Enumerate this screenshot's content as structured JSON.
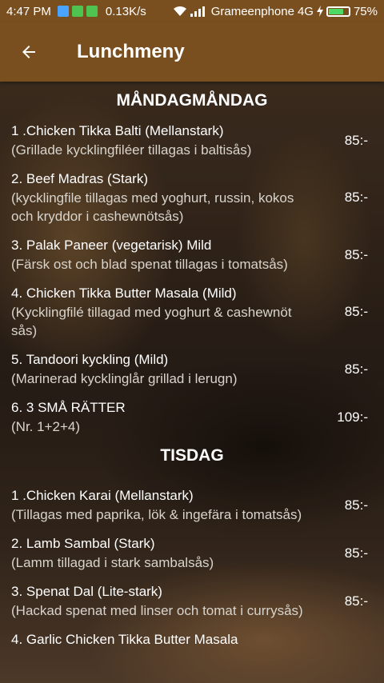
{
  "status_bar": {
    "time": "4:47 PM",
    "speed": "0.13K/s",
    "carrier": "Grameenphone",
    "network": "4G",
    "battery": "75%",
    "battery_level": 0.75
  },
  "app_bar": {
    "title": "Lunchmeny",
    "back_icon": "arrow-left-icon"
  },
  "days": [
    {
      "day": "MÅNDAGMÅNDAG",
      "items": [
        {
          "name": "1 .Chicken Tikka Balti (Mellanstark)",
          "desc": "(Grillade kycklingfiléer tillagas i baltisås)",
          "price": "85:-"
        },
        {
          "name": "2. Beef Madras (Stark)",
          "desc": "(kycklingfile tillagas med yoghurt, russin, kokos och kryddor i cashewnötsås)",
          "price": "85:-"
        },
        {
          "name": "3. Palak Paneer (vegetarisk) Mild",
          "desc": "(Färsk ost och blad spenat tillagas i tomatsås)",
          "price": "85:-"
        },
        {
          "name": "4. Chicken Tikka Butter Masala (Mild)",
          "desc": "(Kycklingfilé tillagad med yoghurt & cashewnöt sås)",
          "price": "85:-"
        },
        {
          "name": "5. Tandoori kyckling (Mild)",
          "desc": "(Marinerad kycklinglår grillad i lerugn)",
          "price": "85:-"
        },
        {
          "name": "6. 3 SMÅ RÄTTER",
          "desc": "(Nr. 1+2+4)",
          "price": "109:-"
        }
      ]
    },
    {
      "day": "TISDAG",
      "items": [
        {
          "name": "1 .Chicken Karai (Mellanstark)",
          "desc": "(Tillagas med paprika, lök & ingefära i tomatsås)",
          "price": "85:-"
        },
        {
          "name": "2. Lamb Sambal (Stark)",
          "desc": "(Lamm tillagad i stark sambalsås)",
          "price": "85:-"
        },
        {
          "name": "3. Spenat Dal (Lite-stark)",
          "desc": "(Hackad spenat med linser och tomat i currysås)",
          "price": "85:-"
        },
        {
          "name": "4. Garlic Chicken Tikka Butter Masala",
          "desc": "",
          "price": ""
        }
      ]
    }
  ]
}
